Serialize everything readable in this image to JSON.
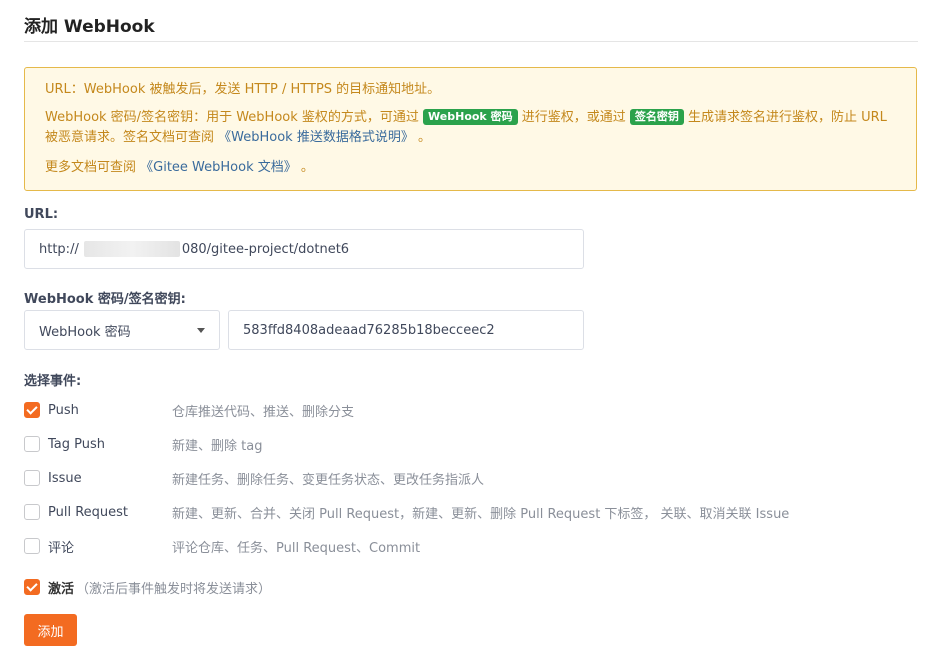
{
  "page": {
    "title": "添加 WebHook"
  },
  "notice": {
    "line1": "URL：WebHook 被触发后，发送 HTTP / HTTPS 的目标通知地址。",
    "line2_a": "WebHook 密码/签名密钥：用于 WebHook 鉴权的方式，可通过 ",
    "tag_password": "WebHook 密码",
    "line2_b": " 进行鉴权，或通过 ",
    "tag_signature": "签名密钥",
    "line2_c": " 生成请求签名进行鉴权，防止 URL 被恶意请求。签名文档可查阅 ",
    "link_format": "《WebHook 推送数据格式说明》",
    "line2_d": " 。",
    "line3_a": "更多文档可查阅 ",
    "link_docs": "《Gitee WebHook 文档》",
    "line3_b": " 。"
  },
  "url": {
    "label": "URL:",
    "value_prefix": "http://",
    "value_suffix": "080/gitee-project/dotnet6"
  },
  "secret": {
    "label": "WebHook 密码/签名密钥:",
    "type_selected": "WebHook 密码",
    "value": "583ffd8408adeaad76285b18becceec2"
  },
  "events": {
    "label": "选择事件:",
    "items": [
      {
        "name": "Push",
        "desc": "仓库推送代码、推送、删除分支",
        "checked": true
      },
      {
        "name": "Tag Push",
        "desc": "新建、删除 tag",
        "checked": false
      },
      {
        "name": "Issue",
        "desc": "新建任务、删除任务、变更任务状态、更改任务指派人",
        "checked": false
      },
      {
        "name": "Pull Request",
        "desc": "新建、更新、合并、关闭 Pull Request，新建、更新、删除 Pull Request 下标签， 关联、取消关联 Issue",
        "checked": false
      },
      {
        "name": "评论",
        "desc": "评论仓库、任务、Pull Request、Commit",
        "checked": false
      }
    ]
  },
  "activate": {
    "label": "激活",
    "note": "（激活后事件触发时将发送请求）",
    "checked": true
  },
  "submit": {
    "label": "添加"
  },
  "colors": {
    "accent": "#f36b21",
    "notice_bg": "#fff9e6",
    "notice_border": "#e5b94a",
    "tag_green": "#2ba24c"
  }
}
